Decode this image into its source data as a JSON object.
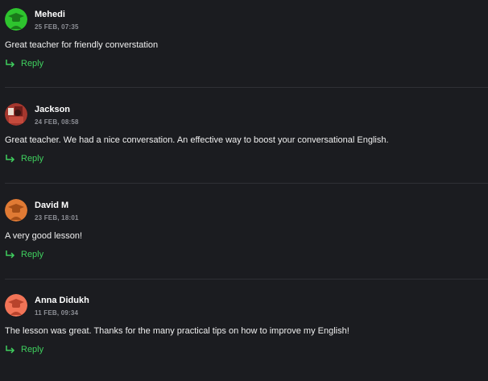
{
  "comments": [
    {
      "author": "Mehedi",
      "date": "25 FEB, 07:35",
      "text": "Great teacher for friendly converstation",
      "reply_label": "Reply",
      "avatar_icon": "student-avatar-icon",
      "avatar_color": "#2ec42e"
    },
    {
      "author": "Jackson",
      "date": "24 FEB, 08:58",
      "text": "Great teacher. We had a nice conversation. An effective way to boost your conversational English.",
      "reply_label": "Reply",
      "avatar_icon": "user-photo-avatar",
      "avatar_color": "#a5372e"
    },
    {
      "author": "David M",
      "date": "23 FEB, 18:01",
      "text": "A very good lesson!",
      "reply_label": "Reply",
      "avatar_icon": "student-avatar-icon",
      "avatar_color": "#e07a34"
    },
    {
      "author": "Anna Didukh",
      "date": "11 FEB, 09:34",
      "text": "The lesson was great. Thanks for the many practical tips on how to improve my English!",
      "reply_label": "Reply",
      "avatar_icon": "student-avatar-icon",
      "avatar_color": "#f27457"
    }
  ],
  "colors": {
    "background": "#1b1c20",
    "accent": "#3fcf5e",
    "divider": "#2f3035"
  }
}
